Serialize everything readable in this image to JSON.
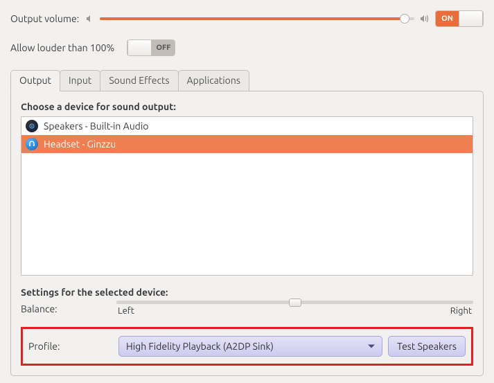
{
  "volume": {
    "label": "Output volume:",
    "percent": 97,
    "switch_on": "ON",
    "switch_off": "OFF",
    "state": "on"
  },
  "louder": {
    "label": "Allow louder than 100%",
    "switch_on": "ON",
    "switch_off": "OFF",
    "state": "off"
  },
  "tabs": {
    "output": "Output",
    "input": "Input",
    "effects": "Sound Effects",
    "apps": "Applications",
    "active": "output"
  },
  "output_panel": {
    "choose_label": "Choose a device for sound output:",
    "devices": [
      {
        "name": "Speakers - Built-in Audio",
        "icon": "builtin",
        "selected": false
      },
      {
        "name": "Headset - Ginzzu",
        "icon": "bt",
        "selected": true
      }
    ],
    "settings_label": "Settings for the selected device:",
    "balance": {
      "label": "Balance:",
      "left": "Left",
      "right": "Right",
      "value": 50
    },
    "profile": {
      "label": "Profile:",
      "selected": "High Fidelity Playback (A2DP Sink)",
      "test_button": "Test Speakers"
    }
  }
}
